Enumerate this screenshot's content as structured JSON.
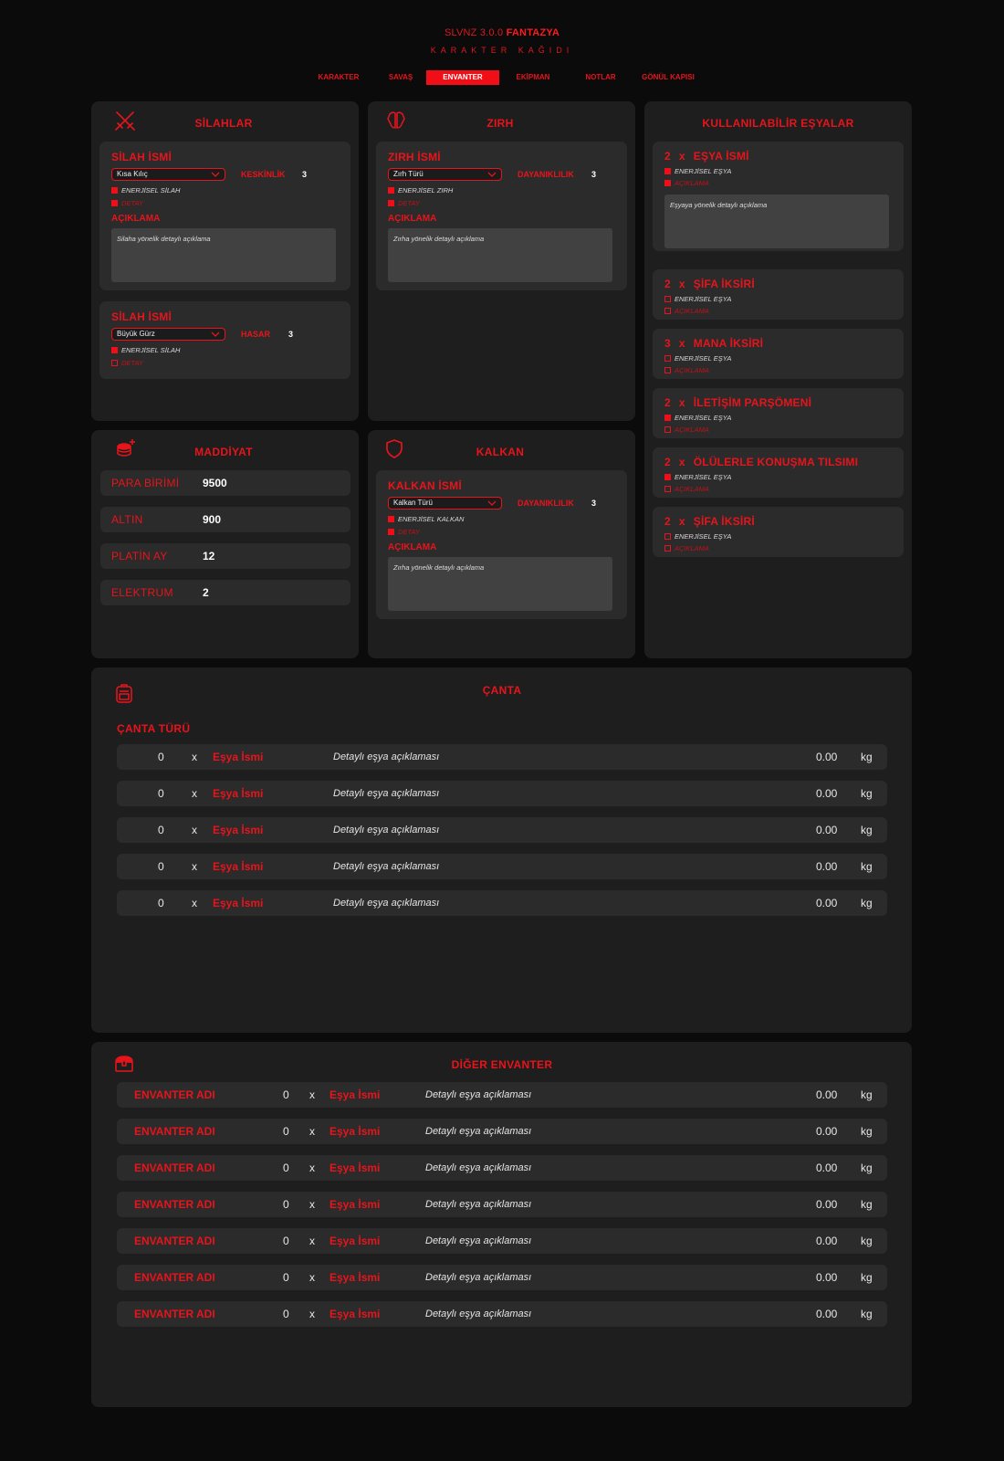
{
  "header": {
    "version": "SLVNZ 3.0.0",
    "brand": "FANTAZYA",
    "subtitle": "KARAKTER KAĞIDI"
  },
  "nav": [
    "KARAKTER",
    "SAVAŞ",
    "ENVANTER",
    "EKİPMAN",
    "NOTLAR",
    "GÖNÜL KAPISI"
  ],
  "nav_active": "ENVANTER",
  "weapons": {
    "title": "SİLAHLAR",
    "icon": "crossed-swords-icon",
    "items": [
      {
        "name": "SİLAH İSMİ",
        "type": "Kısa Kılıç",
        "stat_label": "KESKİNLİK",
        "stat_value": "3",
        "energy": "ENERJİSEL SİLAH",
        "detail": "DETAY",
        "desc_label": "AÇIKLAMA",
        "desc": "Silaha yönelik detaylı açıklama"
      },
      {
        "name": "SİLAH İSMİ",
        "type": "Büyük Gürz",
        "stat_label": "HASAR",
        "stat_value": "3",
        "energy": "ENERJİSEL SİLAH",
        "detail": "DETAY"
      }
    ]
  },
  "armor": {
    "title": "ZIRH",
    "icon": "armor-icon",
    "item": {
      "name": "ZIRH İSMİ",
      "type": "Zırh Türü",
      "stat_label": "DAYANIKLILIK",
      "stat_value": "3",
      "energy": "ENERJİSEL ZIRH",
      "detail": "DETAY",
      "desc_label": "AÇIKLAMA",
      "desc": "Zırha yönelik detaylı açıklama"
    }
  },
  "consumables": {
    "title": "KULLANILABİLİR EŞYALAR",
    "items": [
      {
        "qty": "2",
        "x": "x",
        "name": "EŞYA İSMİ",
        "energy": "ENERJİSEL EŞYA",
        "desc_label": "AÇIKLAMA",
        "desc": "Eşyaya yönelik detaylı açıklama"
      },
      {
        "qty": "2",
        "x": "x",
        "name": "ŞİFA İKSİRİ",
        "energy": "ENERJİSEL EŞYA",
        "desc_label": "AÇIKLAMA"
      },
      {
        "qty": "3",
        "x": "x",
        "name": "MANA İKSİRİ",
        "energy": "ENERJİSEL EŞYA",
        "desc_label": "AÇIKLAMA"
      },
      {
        "qty": "2",
        "x": "x",
        "name": "İLETİŞİM PARŞÖMENİ",
        "energy": "ENERJİSEL EŞYA",
        "desc_label": "AÇIKLAMA"
      },
      {
        "qty": "2",
        "x": "x",
        "name": "ÖLÜLERLE KONUŞMA TILSIMI",
        "energy": "ENERJİSEL EŞYA",
        "desc_label": "AÇIKLAMA"
      },
      {
        "qty": "2",
        "x": "x",
        "name": "ŞİFA İKSİRİ",
        "energy": "ENERJİSEL EŞYA",
        "desc_label": "AÇIKLAMA"
      }
    ]
  },
  "money": {
    "title": "MADDİYAT",
    "icon": "coins-icon",
    "rows": [
      {
        "label": "PARA BİRİMİ",
        "value": "9500"
      },
      {
        "label": "ALTIN",
        "value": "900"
      },
      {
        "label": "PLATİN AY",
        "value": "12"
      },
      {
        "label": "ELEKTRUM",
        "value": "2"
      }
    ]
  },
  "shield": {
    "title": "KALKAN",
    "icon": "shield-icon",
    "item": {
      "name": "KALKAN İSMİ",
      "type": "Kalkan Türü",
      "stat_label": "DAYANIKLILIK",
      "stat_value": "3",
      "energy": "ENERJİSEL KALKAN",
      "detail": "DETAY",
      "desc_label": "AÇIKLAMA",
      "desc": "Zırha yönelik detaylı açıklama"
    }
  },
  "bag": {
    "title": "ÇANTA",
    "icon": "backpack-icon",
    "type_label": "ÇANTA TÜRÜ",
    "rows": [
      {
        "qty": "0",
        "x": "x",
        "name": "Eşya İsmi",
        "desc": "Detaylı eşya açıklaması",
        "weight": "0.00",
        "unit": "kg"
      },
      {
        "qty": "0",
        "x": "x",
        "name": "Eşya İsmi",
        "desc": "Detaylı eşya açıklaması",
        "weight": "0.00",
        "unit": "kg"
      },
      {
        "qty": "0",
        "x": "x",
        "name": "Eşya İsmi",
        "desc": "Detaylı eşya açıklaması",
        "weight": "0.00",
        "unit": "kg"
      },
      {
        "qty": "0",
        "x": "x",
        "name": "Eşya İsmi",
        "desc": "Detaylı eşya açıklaması",
        "weight": "0.00",
        "unit": "kg"
      },
      {
        "qty": "0",
        "x": "x",
        "name": "Eşya İsmi",
        "desc": "Detaylı eşya açıklaması",
        "weight": "0.00",
        "unit": "kg"
      }
    ]
  },
  "other": {
    "title": "DİĞER ENVANTER",
    "icon": "chest-icon",
    "rows": [
      {
        "inv": "ENVANTER ADI",
        "qty": "0",
        "x": "x",
        "name": "Eşya İsmi",
        "desc": "Detaylı eşya açıklaması",
        "weight": "0.00",
        "unit": "kg"
      },
      {
        "inv": "ENVANTER ADI",
        "qty": "0",
        "x": "x",
        "name": "Eşya İsmi",
        "desc": "Detaylı eşya açıklaması",
        "weight": "0.00",
        "unit": "kg"
      },
      {
        "inv": "ENVANTER ADI",
        "qty": "0",
        "x": "x",
        "name": "Eşya İsmi",
        "desc": "Detaylı eşya açıklaması",
        "weight": "0.00",
        "unit": "kg"
      },
      {
        "inv": "ENVANTER ADI",
        "qty": "0",
        "x": "x",
        "name": "Eşya İsmi",
        "desc": "Detaylı eşya açıklaması",
        "weight": "0.00",
        "unit": "kg"
      },
      {
        "inv": "ENVANTER ADI",
        "qty": "0",
        "x": "x",
        "name": "Eşya İsmi",
        "desc": "Detaylı eşya açıklaması",
        "weight": "0.00",
        "unit": "kg"
      },
      {
        "inv": "ENVANTER ADI",
        "qty": "0",
        "x": "x",
        "name": "Eşya İsmi",
        "desc": "Detaylı eşya açıklaması",
        "weight": "0.00",
        "unit": "kg"
      },
      {
        "inv": "ENVANTER ADI",
        "qty": "0",
        "x": "x",
        "name": "Eşya İsmi",
        "desc": "Detaylı eşya açıklaması",
        "weight": "0.00",
        "unit": "kg"
      }
    ]
  },
  "colors": {
    "accent": "#e8141b",
    "background": "#0b0b0b",
    "panel": "#1e1e1e",
    "card": "#2b2b2b"
  }
}
